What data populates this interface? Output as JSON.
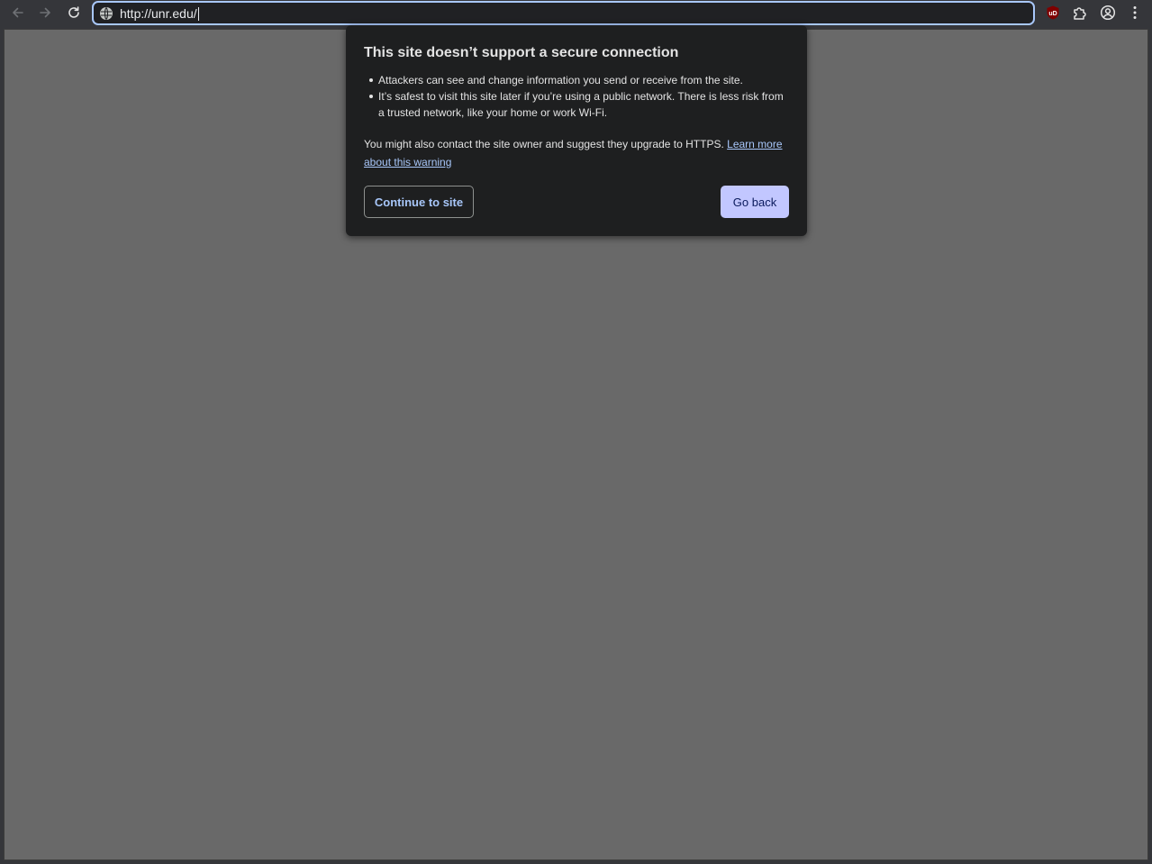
{
  "toolbar": {
    "back_icon": "arrow-left-icon",
    "forward_icon": "arrow-right-icon",
    "reload_icon": "reload-icon",
    "omnibox": {
      "site_info_icon": "globe-icon",
      "url": "http://unr.edu/"
    },
    "extensions": {
      "ublock_icon": "ublock-origin-icon",
      "ublock_badge": "uD",
      "puzzle_icon": "extensions-puzzle-icon",
      "profile_icon": "profile-icon",
      "menu_icon": "kebab-menu-icon"
    }
  },
  "warning": {
    "title": "This site doesn’t support a secure connection",
    "bullets": [
      "Attackers can see and change information you send or receive from the site.",
      "It’s safest to visit this site later if you’re using a public network. There is less risk from a trusted network, like your home or work Wi-Fi."
    ],
    "paragraph": "You might also contact the site owner and suggest they upgrade to HTTPS.",
    "learn_more_link": "Learn more about this warning",
    "continue_button": "Continue to site",
    "back_button": "Go back"
  },
  "colors": {
    "toolbar_bg": "#35363a",
    "content_bg": "#696969",
    "popup_bg": "#1e1f20",
    "accent": "#a8c7fa",
    "primary_button_bg": "#c2c7ff",
    "ublock_red": "#800000"
  }
}
